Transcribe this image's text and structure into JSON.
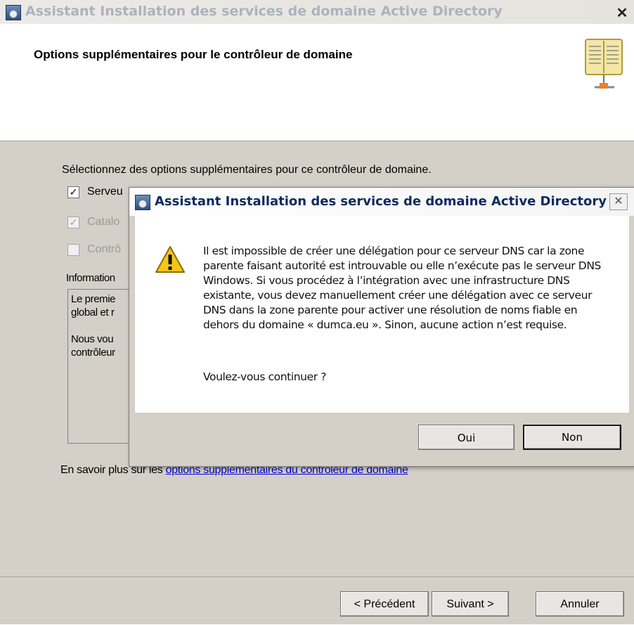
{
  "main_window": {
    "title": "Assistant Installation des services de domaine Active Directory",
    "close_glyph": "✕",
    "header_title": "Options supplémentaires pour le contrôleur de domaine",
    "intro": "Sélectionnez des options supplémentaires pour ce contrôleur de domaine.",
    "checkboxes": [
      {
        "label": "Serveu",
        "checked": true,
        "enabled": true
      },
      {
        "label": "Catalo",
        "checked": true,
        "enabled": false
      },
      {
        "label": "Contrô",
        "checked": false,
        "enabled": false
      }
    ],
    "info_label": "Information",
    "info_text": "Le premie\nglobal et r\n\nNous vou\ncontrôleur",
    "learn_more_prefix": "En savoir plus sur les ",
    "learn_more_link": "options supplémentaires du contrôleur de domaine",
    "buttons": {
      "back": "< Précédent",
      "next": "Suivant >",
      "cancel": "Annuler"
    }
  },
  "message_box": {
    "title": "Assistant Installation des services de domaine Active Directory",
    "close_glyph": "✕",
    "icon": "warning-icon",
    "message": "Il est impossible de créer une délégation pour ce serveur DNS car la zone parente faisant autorité est introuvable ou elle n’exécute pas le serveur DNS Windows. Si vous procédez à l’intégration avec une infrastructure DNS existante, vous devez manuellement créer une délégation avec ce serveur DNS dans la zone parente pour activer une résolution de noms fiable en dehors du domaine « dumca.eu ». Sinon, aucune action n’est requise.",
    "question": "Voulez-vous continuer ?",
    "buttons": {
      "yes": "Oui",
      "no": "Non"
    }
  },
  "colors": {
    "dialog_face": "#d4d0c8",
    "link": "#0000cc",
    "msg_title": "#0d2a5e",
    "warning_fill": "#f5c518"
  }
}
